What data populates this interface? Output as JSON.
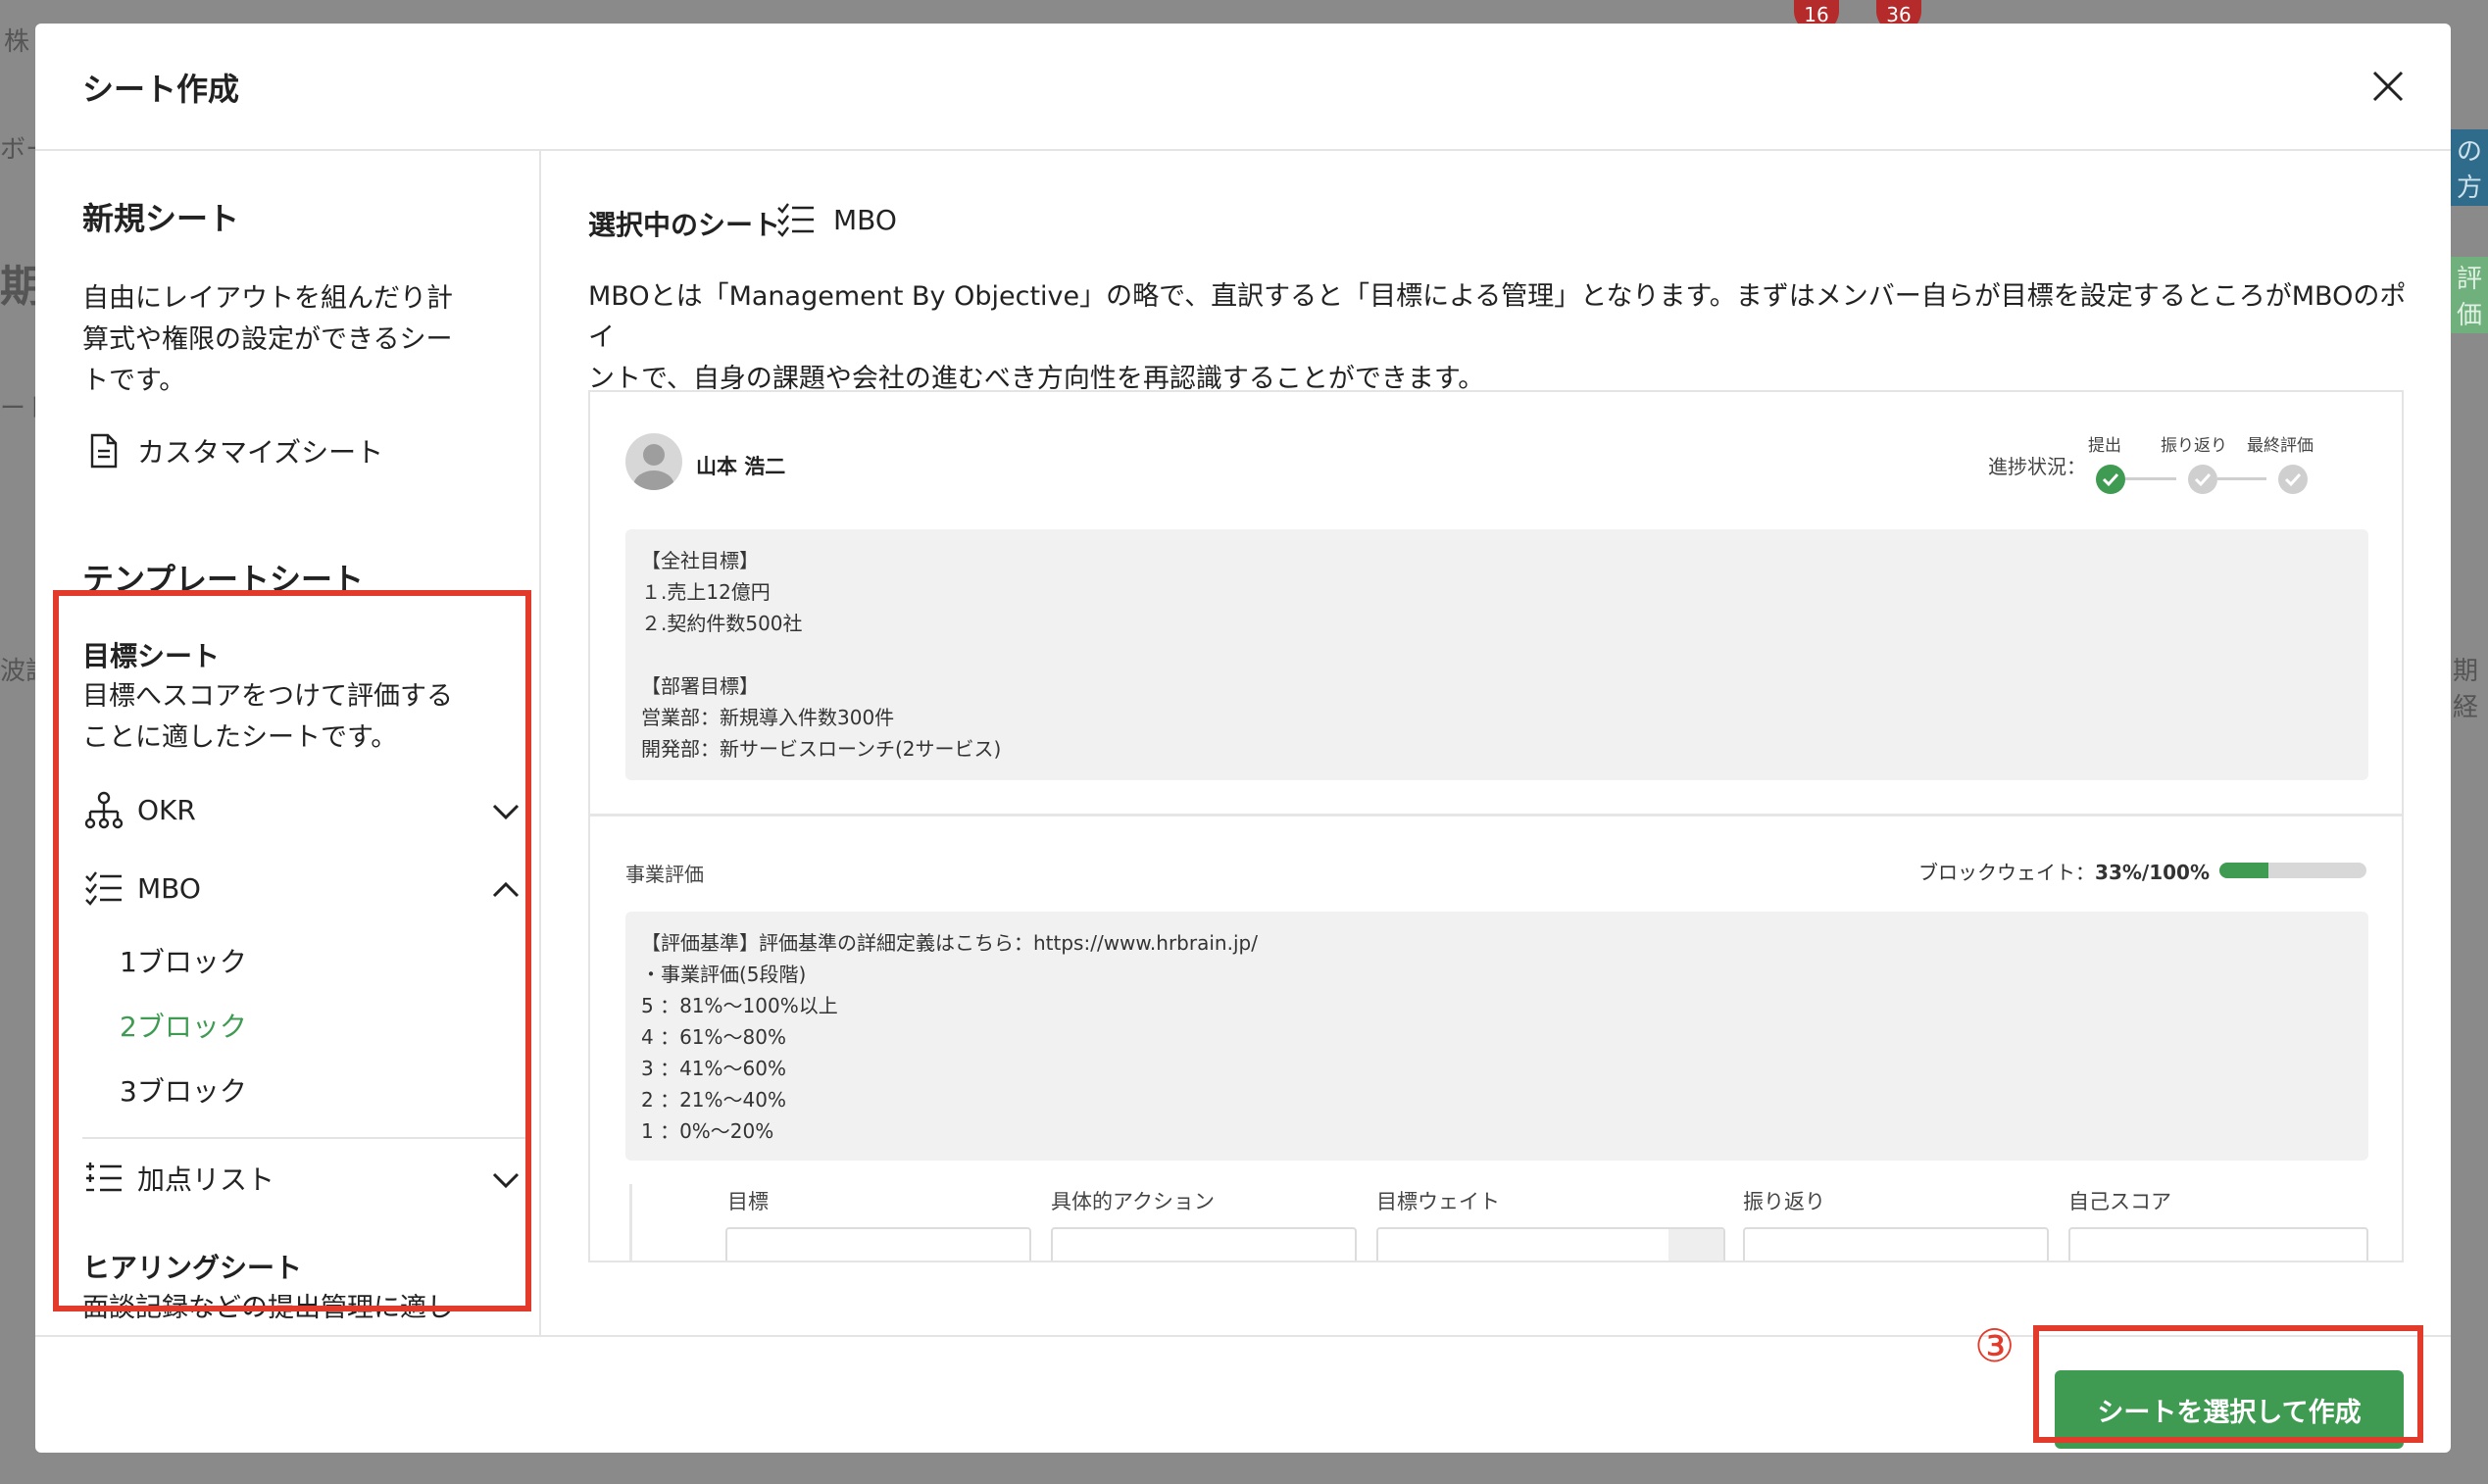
{
  "backdrop": {
    "company_fragment": "株",
    "nav_fragment": "ボー",
    "heading_fragment": "期",
    "tab_fragment": "ート",
    "col_fragment": "波評",
    "right_button_fragment": "の方",
    "right_tab_fragment": "評価",
    "right_col_fragment": "期経",
    "badge_1": "16",
    "badge_2": "36"
  },
  "modal": {
    "title": "シート作成"
  },
  "sidebar": {
    "new_sheet_heading": "新規シート",
    "new_sheet_desc_lines": [
      "自由にレイアウトを組んだり計",
      "算式や権限の設定ができるシー",
      "トです。"
    ],
    "custom_sheet_label": "カスタマイズシート",
    "template_heading": "テンプレートシート",
    "goal_sheet_heading": "目標シート",
    "goal_sheet_desc_lines": [
      "目標へスコアをつけて評価する",
      "ことに適したシートです。"
    ],
    "items": [
      {
        "label": "OKR",
        "icon": "org-chart-icon",
        "expanded": false
      },
      {
        "label": "MBO",
        "icon": "checklist-icon",
        "expanded": true
      },
      {
        "label": "加点リスト",
        "icon": "add-list-icon",
        "expanded": false
      }
    ],
    "mbo_subitems": [
      "1ブロック",
      "2ブロック",
      "3ブロック"
    ],
    "mbo_selected": "2ブロック",
    "hearing_heading": "ヒアリングシート",
    "hearing_desc": "面談記録などの提出管理に適し"
  },
  "content": {
    "selected_label": "選択中のシート",
    "selected_name": "MBO",
    "description_lines": [
      "MBOとは「Management By Objective」の略で、直訳すると「目標による管理」となります。まずはメンバー自らが目標を設定するところがMBOのポイ",
      "ントで、自身の課題や会社の進むべき方向性を再認識することができます。"
    ]
  },
  "preview": {
    "user_name": "山本 浩二",
    "progress_label": "進捗状況：",
    "steps": [
      "提出",
      "振り返り",
      "最終評価"
    ],
    "steps_done": 1,
    "company_goals_lines": [
      "【全社目標】",
      "１.売上12億円",
      "２.契約件数500社",
      "",
      "【部署目標】",
      "営業部：新規導入件数300件",
      "開発部：新サービスローンチ(2サービス)"
    ],
    "section_title": "事業評価",
    "block_weight_label": "ブロックウェイト：",
    "block_weight_value": "33%/100%",
    "block_weight_fraction": 0.33,
    "criteria_lines": [
      "【評価基準】評価基準の詳細定義はこちら：https://www.hrbrain.jp/",
      "・事業評価(5段階)",
      "5 ：81%〜100%以上",
      "4 ：61%〜80%",
      "3 ：41%〜60%",
      "2 ：21%〜40%",
      "1 ：0%〜20%"
    ],
    "columns": [
      "目標",
      "具体的アクション",
      "目標ウェイト",
      "振り返り",
      "自己スコア"
    ]
  },
  "footer": {
    "step_marker": "③",
    "create_button": "シートを選択して作成"
  },
  "colors": {
    "accent_green": "#3f9a52",
    "highlight_red": "#e23b2b"
  }
}
